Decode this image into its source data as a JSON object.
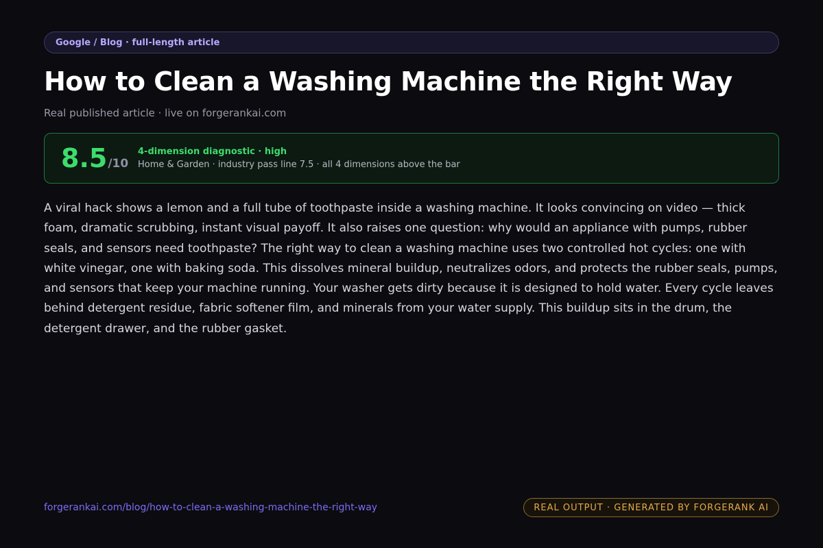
{
  "breadcrumb": "Google / Blog · full-length article",
  "title": "How to Clean a Washing Machine the Right Way",
  "subtitle": "Real published article · live on forgerankai.com",
  "score": {
    "value": "8.5",
    "max": "/10",
    "label": "4-dimension diagnostic · high",
    "description": "Home & Garden · industry pass line 7.5 · all 4 dimensions above the bar"
  },
  "article": {
    "body": "A viral hack shows a lemon and a full tube of toothpaste inside a washing machine. It looks convincing on video — thick foam, dramatic scrubbing, instant visual payoff. It also raises one question: why would an appliance with pumps, rubber seals, and sensors need toothpaste? The right way to clean a washing machine uses two controlled hot cycles: one with white vinegar, one with baking soda. This dissolves mineral buildup, neutralizes odors, and protects the rubber seals, pumps, and sensors that keep your machine running. Your washer gets dirty because it is designed to hold water. Every cycle leaves behind detergent residue, fabric softener film, and minerals from your water supply. This buildup sits in the drum, the detergent drawer, and the rubber gasket."
  },
  "footer": {
    "url": "forgerankai.com/blog/how-to-clean-a-washing-machine-the-right-way",
    "badge": "REAL OUTPUT · GENERATED BY FORGERANK AI"
  },
  "colors": {
    "background": "#0b0b10",
    "accent_purple": "#b9a7ff",
    "score_green": "#3ddc6c",
    "badge_amber": "#e7a94a"
  }
}
